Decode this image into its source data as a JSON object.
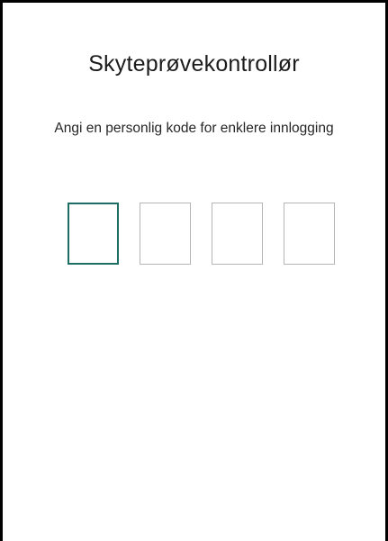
{
  "screen": {
    "title": "Skyteprøvekontrollør",
    "instruction": "Angi en personlig kode for enklere innlogging"
  },
  "pin": {
    "length": 4,
    "active_index": 0,
    "digits": [
      {
        "value": ""
      },
      {
        "value": ""
      },
      {
        "value": ""
      },
      {
        "value": ""
      }
    ]
  },
  "colors": {
    "background": "#ffffff",
    "active_border": "#1f6e66",
    "inactive_border": "#b5b5b5",
    "text": "#1c1c1c",
    "window_border": "#000000"
  }
}
